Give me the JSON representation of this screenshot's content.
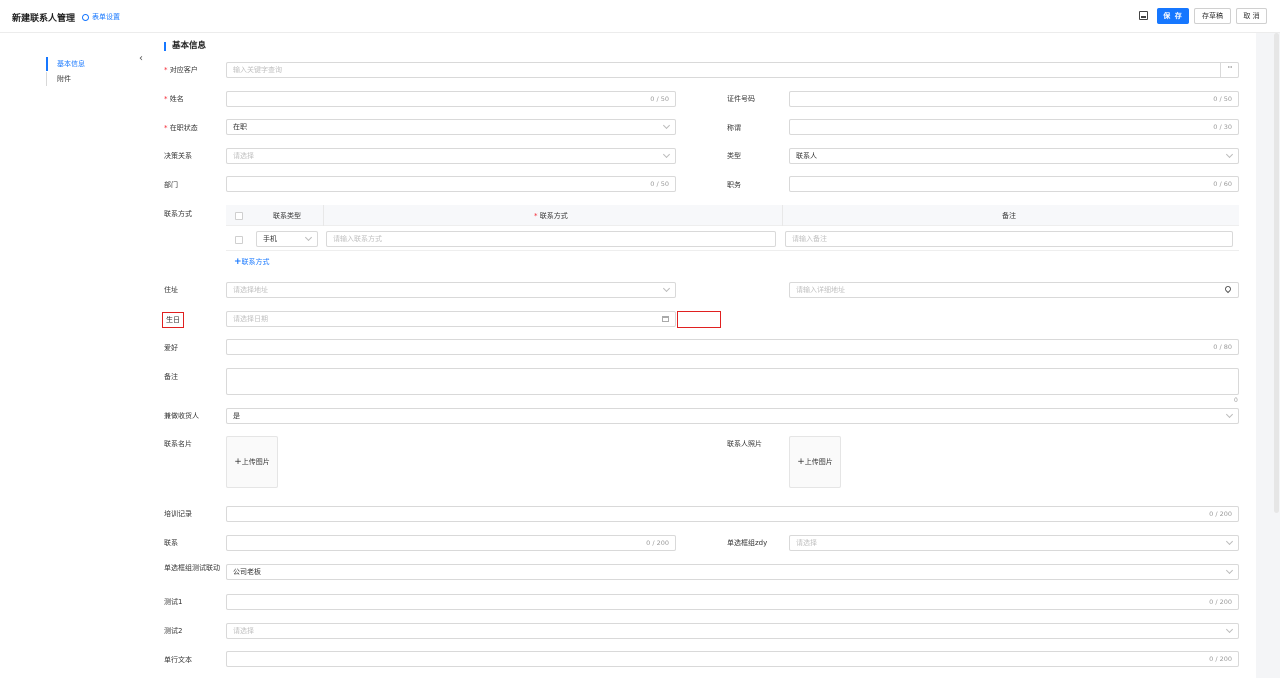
{
  "header": {
    "title": "新建联系人管理",
    "form_settings": "表单设置",
    "save": "保 存",
    "draft": "存草稿",
    "cancel": "取 消"
  },
  "sidebar": {
    "items": [
      {
        "label": "基本信息"
      },
      {
        "label": "附件"
      }
    ]
  },
  "section": {
    "title": "基本信息"
  },
  "form": {
    "customer": {
      "label": "对应客户",
      "placeholder": "输入关键字查询"
    },
    "name": {
      "label": "姓名",
      "count": "0 / 50"
    },
    "idno": {
      "label": "证件号码",
      "count": "0 / 50"
    },
    "status": {
      "label": "在职状态",
      "value": "在职"
    },
    "honorific": {
      "label": "称谓",
      "count": "0 / 30"
    },
    "decision": {
      "label": "决策关系",
      "placeholder": "请选择"
    },
    "type": {
      "label": "类型",
      "value": "联系人"
    },
    "dept": {
      "label": "部门",
      "count": "0 / 50"
    },
    "position": {
      "label": "职务",
      "count": "0 / 60"
    },
    "contact": {
      "label": "联系方式",
      "headers": [
        "联系类型",
        "联系方式",
        "备注"
      ],
      "row": {
        "type": "手机",
        "value_placeholder": "请输入联系方式",
        "note_placeholder": "请输入备注"
      },
      "add": "联系方式"
    },
    "address": {
      "label": "住址",
      "placeholder": "请选择地址",
      "detail_placeholder": "请输入详细地址"
    },
    "birthday": {
      "label": "生日",
      "placeholder": "请选择日期"
    },
    "hobby": {
      "label": "爱好",
      "count": "0 / 80"
    },
    "remark": {
      "label": "备注",
      "count": "0"
    },
    "receiver": {
      "label": "兼做收货人",
      "value": "是"
    },
    "card": {
      "label": "联系名片",
      "upload": "上传图片"
    },
    "photo": {
      "label": "联系人照片",
      "upload": "上传图片"
    },
    "training": {
      "label": "培训记录",
      "count": "0 / 200"
    },
    "link": {
      "label": "联系",
      "count": "0 / 200"
    },
    "radio_zdy": {
      "label": "单选框组zdy",
      "placeholder": "请选择"
    },
    "radio_linkage": {
      "label": "单选框组测试联动",
      "value": "公司老板"
    },
    "test1": {
      "label": "测试1",
      "count": "0 / 200"
    },
    "test2": {
      "label": "测试2",
      "placeholder": "请选择"
    },
    "single_text": {
      "label": "单行文本",
      "count": "0 / 200"
    }
  },
  "colors": {
    "accent": "#1677ff",
    "required": "#f5222d",
    "highlight": "#e02020"
  }
}
